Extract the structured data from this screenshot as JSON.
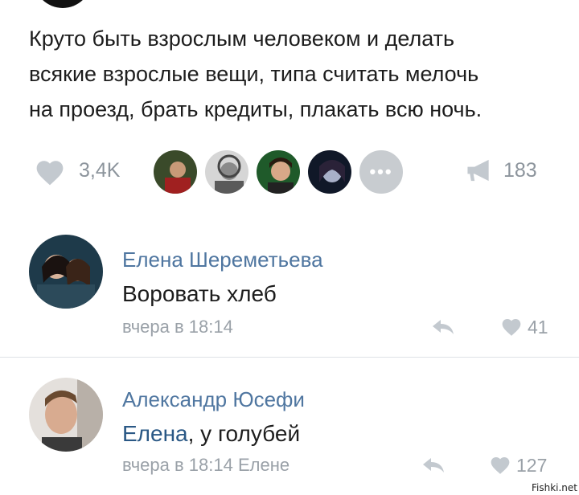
{
  "post": {
    "lines": [
      "Круто быть взрослым человеком и делать",
      "всякие взрослые вещи, типа считать мелочь",
      "на проезд, брать кредиты, плакать всю ночь."
    ],
    "like_count": "3,4K",
    "share_count": "183",
    "more_label": "•••",
    "icons": {
      "like": "heart-icon",
      "share": "megaphone-icon",
      "more": "more-dots-icon"
    }
  },
  "comments": [
    {
      "author": "Елена Шереметьева",
      "text": "Воровать хлеб",
      "meta": "вчера в 18:14",
      "likes": "41"
    },
    {
      "author": "Александр Юсефи",
      "mention": "Елена",
      "text_rest": ", у голубей",
      "meta": "вчера в 18:14 Елене",
      "likes": "127"
    }
  ],
  "colors": {
    "link": "#4f76a0",
    "muted": "#9aa1a8",
    "icon": "#c3c9cf"
  },
  "watermark": "Fishki.net"
}
